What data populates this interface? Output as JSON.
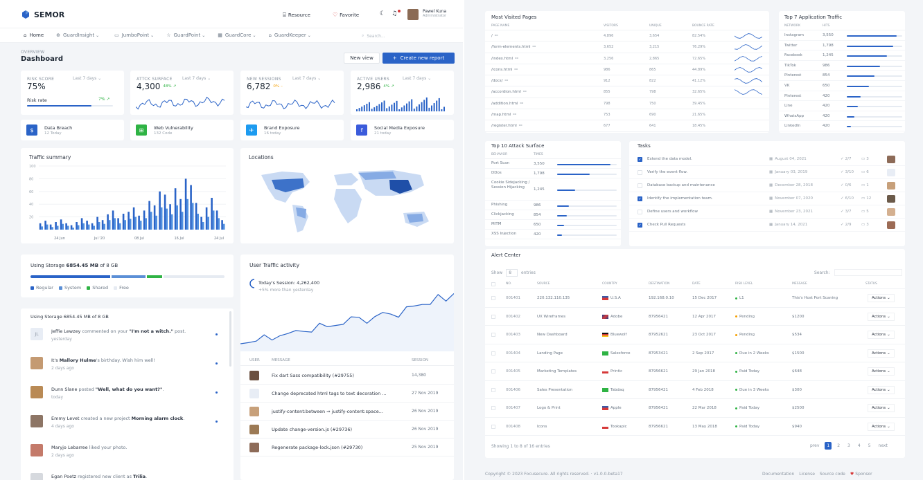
{
  "brand": {
    "name": "SEMOR"
  },
  "header": {
    "resource": "Resource",
    "favorite": "Favorite",
    "user_name": "Pawel Kuna",
    "user_role": "Administrator"
  },
  "nav": {
    "items": [
      "Home",
      "GuardInsight",
      "JumboPoint",
      "GuardPoint",
      "GuardCore",
      "GuardKeeper"
    ],
    "search_placeholder": "Search..."
  },
  "page": {
    "overline": "OVERVIEW",
    "title": "Dashboard",
    "new_view": "New view",
    "create_report": "Create new report"
  },
  "kpis": [
    {
      "label": "RISK SCORE",
      "period": "Last 7 days",
      "value": "75%",
      "sub": "Risk rate",
      "delta": "7%",
      "progress": 0.75
    },
    {
      "label": "ATTCK SURFACE",
      "period": "Last 7 days",
      "value": "4,300",
      "delta": "48%"
    },
    {
      "label": "NEW SESSIONS",
      "period": "Last 7 days",
      "value": "6,782",
      "delta": "0%"
    },
    {
      "label": "ACTIVE USERS",
      "period": "Last 7 days",
      "value": "2,986",
      "delta": "4%"
    }
  ],
  "alerts": [
    {
      "title": "Data Breach",
      "sub": "12 Today",
      "color": "#2a63c7",
      "icon": "dollar-icon"
    },
    {
      "title": "Web Vulnerability",
      "sub": "132 Code",
      "color": "#2fb344",
      "icon": "cart-icon"
    },
    {
      "title": "Brand Exposure",
      "sub": "16 today",
      "color": "#1d9bf0",
      "icon": "twitter-icon"
    },
    {
      "title": "Social Media Exposure",
      "sub": "21 today",
      "color": "#3b5bdb",
      "icon": "facebook-icon"
    }
  ],
  "traffic": {
    "title": "Traffic summary",
    "x_ticks": [
      "24 Jun",
      "Jul '20",
      "08 Jul",
      "16 Jul",
      "24 Jul"
    ],
    "y_ticks": [
      "100",
      "80",
      "60",
      "40",
      "20"
    ]
  },
  "chart_data": {
    "type": "bar",
    "title": "Traffic summary",
    "ylim": [
      0,
      100
    ],
    "series": [
      {
        "name": "s1",
        "values": [
          10,
          14,
          8,
          12,
          16,
          10,
          7,
          12,
          18,
          14,
          10,
          20,
          15,
          24,
          30,
          18,
          25,
          28,
          35,
          22,
          30,
          45,
          38,
          60,
          55,
          40,
          65,
          48,
          80,
          70,
          42,
          20,
          35,
          50,
          30,
          15
        ]
      },
      {
        "name": "s2",
        "values": [
          5,
          8,
          4,
          6,
          9,
          6,
          3,
          7,
          10,
          8,
          6,
          12,
          9,
          15,
          18,
          10,
          15,
          17,
          20,
          14,
          18,
          28,
          22,
          35,
          33,
          24,
          38,
          28,
          48,
          42,
          25,
          12,
          20,
          30,
          18,
          9
        ]
      }
    ]
  },
  "locations": {
    "title": "Locations"
  },
  "storage": {
    "text": "Using Storage",
    "amount": "6854.45 MB",
    "of": "of 8 GB",
    "legend": [
      "Regular",
      "System",
      "Shared",
      "Free"
    ],
    "colors": [
      "#2a63c7",
      "#5b8fd6",
      "#2fb344",
      "#e6ebf2"
    ],
    "shares": [
      0.42,
      0.18,
      0.08,
      0.32
    ]
  },
  "activity": {
    "header": "Using Storage 6854.45 MB of 8 GB",
    "items": [
      {
        "pre": "Jeffie Lewzey",
        "mid": " commented on your ",
        "bold": "\"I'm not a witch.\"",
        "post": " post.",
        "time": "yesterday",
        "initial": "JL"
      },
      {
        "pre": "It's ",
        "mid": "",
        "bold": "Mallory Hulme",
        "post": "'s birthday. Wish him well!",
        "time": "2 days ago",
        "initial": ""
      },
      {
        "pre": "Dunn Slane",
        "mid": " posted ",
        "bold": "\"Well, what do you want?\"",
        "post": ".",
        "time": "today",
        "initial": ""
      },
      {
        "pre": "Emmy Levet",
        "mid": " created a new project ",
        "bold": "Morning alarm clock",
        "post": ".",
        "time": "4 days ago",
        "initial": ""
      },
      {
        "pre": "Maryjo Lebarree",
        "mid": " liked your photo.",
        "bold": "",
        "post": "",
        "time": "2 days ago",
        "initial": ""
      },
      {
        "pre": "Egan Poetz",
        "mid": " registered new client as ",
        "bold": "Trilia",
        "post": ".",
        "time": "",
        "initial": ""
      }
    ]
  },
  "user_traffic": {
    "title": "User Traffic activity",
    "session_label": "Today's Session:",
    "session_value": "4,262,400",
    "session_sub": "+5% more than yesterday",
    "values": [
      12,
      18,
      15,
      22,
      20,
      28,
      25,
      30,
      35,
      32,
      40,
      38,
      45,
      42,
      50,
      55,
      48,
      52,
      58,
      62,
      56,
      66,
      70,
      78,
      74,
      85,
      80,
      95
    ]
  },
  "commits": {
    "headers": [
      "USER",
      "MESSAGE",
      "SESSION"
    ],
    "rows": [
      {
        "msg": "Fix dart Sass compatibility (#29755)",
        "date": "14,380"
      },
      {
        "msg": "Change deprecated html tags to text decoration ...",
        "date": "27 Nov 2019"
      },
      {
        "msg": "justify-content:between ⇒ justify-content:space...",
        "date": "26 Nov 2019"
      },
      {
        "msg": "Update change-version.js (#29736)",
        "date": "26 Nov 2019"
      },
      {
        "msg": "Regenerate package-lock.json (#29730)",
        "date": "25 Nov 2019"
      }
    ]
  },
  "most_visited": {
    "title": "Most Visited Pages",
    "headers": [
      "PAGE NAME",
      "VISITORS",
      "UNIQUE",
      "BOUNCE RATE"
    ],
    "rows": [
      [
        "/",
        "4,896",
        "3,654",
        "82.54%"
      ],
      [
        "/form-elements.html",
        "3,652",
        "3,215",
        "76.29%"
      ],
      [
        "/index.html",
        "3,256",
        "2,865",
        "72.65%"
      ],
      [
        "/icons.html",
        "986",
        "865",
        "44.89%"
      ],
      [
        "/docs/",
        "912",
        "822",
        "41.12%"
      ],
      [
        "/accordion.html",
        "855",
        "798",
        "32.65%"
      ],
      [
        "/addition.html",
        "798",
        "750",
        "39.45%"
      ],
      [
        "/map.html",
        "753",
        "690",
        "21.65%"
      ],
      [
        "/register.html",
        "677",
        "641",
        "18.45%"
      ]
    ]
  },
  "app_traffic": {
    "title": "Top 7 Application Traffic",
    "headers": [
      "NETWORK",
      "HITS"
    ],
    "rows": [
      {
        "name": "Instagram",
        "hits": "3,550",
        "frac": 0.9
      },
      {
        "name": "Twitter",
        "hits": "1,798",
        "frac": 0.84
      },
      {
        "name": "Facebook",
        "hits": "1,245",
        "frac": 0.72
      },
      {
        "name": "TikTok",
        "hits": "986",
        "frac": 0.6
      },
      {
        "name": "Pinterest",
        "hits": "854",
        "frac": 0.5
      },
      {
        "name": "VK",
        "hits": "650",
        "frac": 0.4
      },
      {
        "name": "Pinterest",
        "hits": "420",
        "frac": 0.25
      },
      {
        "name": "Line",
        "hits": "420",
        "frac": 0.2
      },
      {
        "name": "WhatsApp",
        "hits": "420",
        "frac": 0.14
      },
      {
        "name": "LinkedIn",
        "hits": "420",
        "frac": 0.08
      }
    ]
  },
  "attack": {
    "title": "Top 10 Attack Surface",
    "headers": [
      "BEHAVIOR",
      "TIMES"
    ],
    "rows": [
      {
        "name": "Port Scan",
        "val": "3,550",
        "frac": 0.9
      },
      {
        "name": "DDos",
        "val": "1,798",
        "frac": 0.55
      },
      {
        "name": "Cookie Sidejacking / Session Hijacking",
        "val": "1,245",
        "frac": 0.3
      },
      {
        "name": "Phishing",
        "val": "986",
        "frac": 0.2
      },
      {
        "name": "Clickjacking",
        "val": "854",
        "frac": 0.16
      },
      {
        "name": "MITM",
        "val": "650",
        "frac": 0.12
      },
      {
        "name": "XSS Injection",
        "val": "420",
        "frac": 0.08
      }
    ]
  },
  "tasks": {
    "title": "Tasks",
    "rows": [
      {
        "checked": true,
        "name": "Extend the data model.",
        "date": "August 04, 2021",
        "check": "2/7",
        "comments": "3"
      },
      {
        "checked": false,
        "name": "Verify the event flow.",
        "date": "January 03, 2019",
        "check": "3/10",
        "comments": "6"
      },
      {
        "checked": false,
        "name": "Database backup and maintenance",
        "date": "December 28, 2018",
        "check": "0/6",
        "comments": "1"
      },
      {
        "checked": true,
        "name": "Identify the implementation team.",
        "date": "November 07, 2020",
        "check": "6/10",
        "comments": "12"
      },
      {
        "checked": false,
        "name": "Define users and workflow",
        "date": "November 23, 2021",
        "check": "3/7",
        "comments": "5"
      },
      {
        "checked": true,
        "name": "Check Pull Requests",
        "date": "January 14, 2021",
        "check": "2/9",
        "comments": "3"
      }
    ]
  },
  "alert_center": {
    "title": "Alert Center",
    "show": "Show",
    "entries_val": "8",
    "entries": "entries",
    "search": "Search:",
    "headers": [
      "NO.",
      "SOURCE",
      "COUNTRY",
      "DESTINATION",
      "DATE",
      "RISK LEVEL",
      "MESSAGE",
      "STATUS"
    ],
    "rows": [
      {
        "no": "001401",
        "src": "220.132.110.135",
        "country": "U.S.A",
        "dest": "192.168.0.10",
        "date": "15 Dec 2017",
        "risk": "L1",
        "risk_color": "#2fb344",
        "msg": "This's Host Port Scaning",
        "flag": "us"
      },
      {
        "no": "001402",
        "src": "UX Wireframes",
        "country": "Adobe",
        "dest": "87956421",
        "date": "12 Apr 2017",
        "risk": "Pending",
        "risk_color": "#f59f00",
        "msg": "$1200",
        "flag": "uk"
      },
      {
        "no": "001403",
        "src": "New Dashboard",
        "country": "Bluewolf",
        "dest": "87952621",
        "date": "23 Oct 2017",
        "risk": "Pending",
        "risk_color": "#f59f00",
        "msg": "$534",
        "flag": "de"
      },
      {
        "no": "001404",
        "src": "Landing Page",
        "country": "Salesforce",
        "dest": "87953421",
        "date": "2 Sep 2017",
        "risk": "Due in 2 Weeks",
        "risk_color": "#2fb344",
        "msg": "$1500",
        "flag": "br"
      },
      {
        "no": "001405",
        "src": "Marketing Templates",
        "country": "Printic",
        "dest": "87956621",
        "date": "29 Jan 2018",
        "risk": "Paid Today",
        "risk_color": "#2fb344",
        "msg": "$648",
        "flag": "pl"
      },
      {
        "no": "001406",
        "src": "Sales Presentation",
        "country": "Tabdaq",
        "dest": "87956421",
        "date": "4 Feb 2018",
        "risk": "Due in 3 Weeks",
        "risk_color": "#2fb344",
        "msg": "$300",
        "flag": "br"
      },
      {
        "no": "001407",
        "src": "Logo & Print",
        "country": "Apple",
        "dest": "87956421",
        "date": "22 Mar 2018",
        "risk": "Paid Today",
        "risk_color": "#2fb344",
        "msg": "$2500",
        "flag": "us"
      },
      {
        "no": "001408",
        "src": "Icons",
        "country": "Tookapic",
        "dest": "87956621",
        "date": "13 May 2018",
        "risk": "Paid Today",
        "risk_color": "#2fb344",
        "msg": "$940",
        "flag": "pl"
      }
    ],
    "action": "Actions",
    "footer": "Showing 1 to 8 of 16 entries",
    "pages": [
      "prev",
      "1",
      "2",
      "3",
      "4",
      "5",
      "next"
    ]
  },
  "footer": {
    "copyright": "Copyright © 2023 Focusecure. All rights reserved.",
    "version": "v1.0.0-beta17",
    "links": [
      "Documentation",
      "License",
      "Source code",
      "Sponsor"
    ]
  }
}
